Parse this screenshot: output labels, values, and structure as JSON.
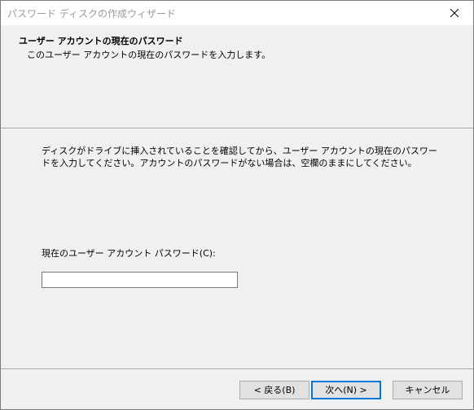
{
  "window": {
    "title": "パスワード ディスクの作成ウィザード"
  },
  "header": {
    "title": "ユーザー アカウントの現在のパスワード",
    "subtitle": "このユーザー アカウントの現在のパスワードを入力します。"
  },
  "body": {
    "instruction_line1": "ディスクがドライブに挿入されていることを確認してから、ユーザー アカウントの現在のパスワー",
    "instruction_line2": "ドを入力してください。アカウントのパスワードがない場合は、空欄のままにしてください。",
    "password_label": "現在のユーザー アカウント パスワード(C):",
    "password_value": ""
  },
  "buttons": {
    "back": "< 戻る(B)",
    "next": "次へ(N) >",
    "cancel": "キャンセル"
  },
  "icons": {
    "close": "close-icon"
  },
  "colors": {
    "default_button_border": "#0078d7",
    "title_text": "#999999"
  }
}
